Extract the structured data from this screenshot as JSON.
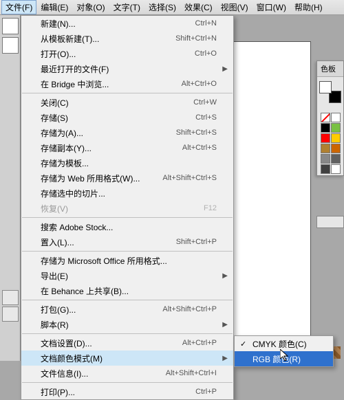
{
  "menubar": {
    "items": [
      {
        "label": "文件(F)"
      },
      {
        "label": "编辑(E)"
      },
      {
        "label": "对象(O)"
      },
      {
        "label": "文字(T)"
      },
      {
        "label": "选择(S)"
      },
      {
        "label": "效果(C)"
      },
      {
        "label": "视图(V)"
      },
      {
        "label": "窗口(W)"
      },
      {
        "label": "帮助(H)"
      }
    ]
  },
  "dropdown": [
    {
      "label": "新建(N)...",
      "shortcut": "Ctrl+N"
    },
    {
      "label": "从模板新建(T)...",
      "shortcut": "Shift+Ctrl+N"
    },
    {
      "label": "打开(O)...",
      "shortcut": "Ctrl+O"
    },
    {
      "label": "最近打开的文件(F)",
      "submenu": true
    },
    {
      "label": "在 Bridge 中浏览...",
      "shortcut": "Alt+Ctrl+O"
    },
    {
      "sep": true
    },
    {
      "label": "关闭(C)",
      "shortcut": "Ctrl+W"
    },
    {
      "label": "存储(S)",
      "shortcut": "Ctrl+S"
    },
    {
      "label": "存储为(A)...",
      "shortcut": "Shift+Ctrl+S"
    },
    {
      "label": "存储副本(Y)...",
      "shortcut": "Alt+Ctrl+S"
    },
    {
      "label": "存储为模板..."
    },
    {
      "label": "存储为 Web 所用格式(W)...",
      "shortcut": "Alt+Shift+Ctrl+S"
    },
    {
      "label": "存储选中的切片..."
    },
    {
      "label": "恢复(V)",
      "shortcut": "F12",
      "disabled": true
    },
    {
      "sep": true
    },
    {
      "label": "搜索 Adobe Stock..."
    },
    {
      "label": "置入(L)...",
      "shortcut": "Shift+Ctrl+P"
    },
    {
      "sep": true
    },
    {
      "label": "存储为 Microsoft Office 所用格式..."
    },
    {
      "label": "导出(E)",
      "submenu": true
    },
    {
      "label": "在 Behance 上共享(B)..."
    },
    {
      "sep": true
    },
    {
      "label": "打包(G)...",
      "shortcut": "Alt+Shift+Ctrl+P"
    },
    {
      "label": "脚本(R)",
      "submenu": true
    },
    {
      "sep": true
    },
    {
      "label": "文档设置(D)...",
      "shortcut": "Alt+Ctrl+P"
    },
    {
      "label": "文档颜色模式(M)",
      "submenu": true,
      "highlight": true
    },
    {
      "label": "文件信息(I)...",
      "shortcut": "Alt+Shift+Ctrl+I"
    },
    {
      "sep": true
    },
    {
      "label": "打印(P)...",
      "shortcut": "Ctrl+P"
    }
  ],
  "submenu": {
    "items": [
      {
        "label": "CMYK 颜色(C)",
        "checked": true
      },
      {
        "label": "RGB 颜色(R)",
        "highlight": true
      }
    ]
  },
  "panels": {
    "swatch_title": "色板",
    "swatches": [
      {
        "color": "none"
      },
      {
        "color": "#ffffff"
      },
      {
        "color": "#000000"
      },
      {
        "color": "#79c142"
      },
      {
        "color": "#ff0000"
      },
      {
        "color": "#ffcc00"
      },
      {
        "color": "#b08030"
      },
      {
        "color": "#cc6600"
      },
      {
        "color": "#888888"
      },
      {
        "color": "#606060"
      },
      {
        "color": "#404040"
      },
      {
        "color": "#ffffff"
      }
    ]
  }
}
